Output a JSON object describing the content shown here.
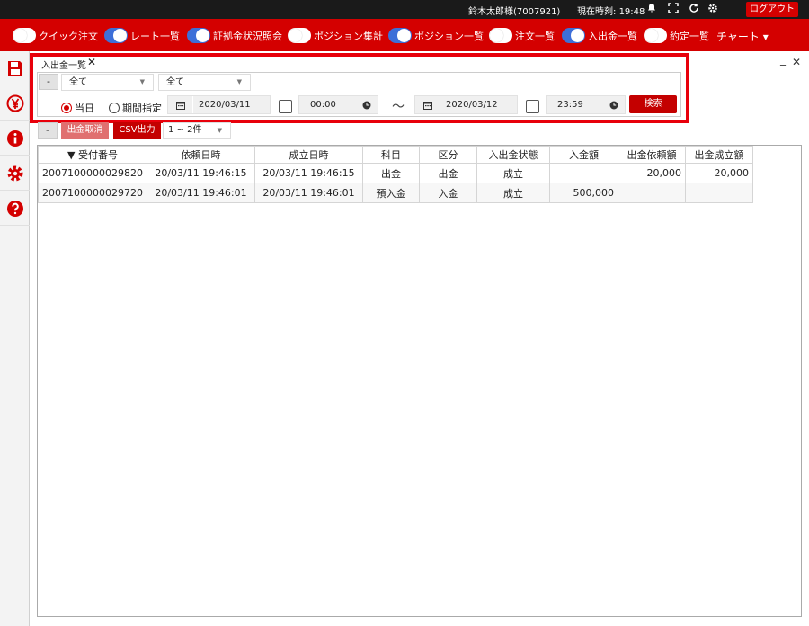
{
  "topbar": {
    "user": "鈴木太郎様(7007921)",
    "clock_label": "現在時刻:",
    "clock_value": "19:48",
    "logout_label": "ログアウト"
  },
  "toolbar": {
    "toggles": [
      {
        "label": "クイック注文",
        "on": false
      },
      {
        "label": "レート一覧",
        "on": true
      },
      {
        "label": "証拠金状況照会",
        "on": true
      },
      {
        "label": "ポジション集計",
        "on": false
      },
      {
        "label": "ポジション一覧",
        "on": true
      },
      {
        "label": "注文一覧",
        "on": false
      },
      {
        "label": "入出金一覧",
        "on": true
      },
      {
        "label": "約定一覧",
        "on": false
      }
    ],
    "chart_menu": "チャート ▾"
  },
  "sidebar": {
    "icons": [
      "save-icon",
      "yen-icon",
      "info-icon",
      "gear-icon",
      "help-icon"
    ]
  },
  "panel": {
    "title": "入出金一覧",
    "close_glyph": "✕",
    "minimize_glyph": "_",
    "panel_close_glyph": "✕"
  },
  "filter": {
    "collapse_label": "-",
    "select1": "全て",
    "select2": "全て",
    "radio_today": "当日",
    "radio_period": "期間指定",
    "date_from": "2020/03/11",
    "time_from": "00:00",
    "tilde": "～",
    "date_to": "2020/03/12",
    "time_to": "23:59",
    "search_label": "検索"
  },
  "actions": {
    "collapse_label": "-",
    "cancel_label": "出金取消",
    "csv_label": "CSV出力",
    "count_label": "1 ~ 2件"
  },
  "table": {
    "headers": [
      "▼ 受付番号",
      "依頼日時",
      "成立日時",
      "科目",
      "区分",
      "入出金状態",
      "入金額",
      "出金依頼額",
      "出金成立額"
    ],
    "rows": [
      [
        "2007100000029820",
        "20/03/11 19:46:15",
        "20/03/11 19:46:15",
        "出金",
        "出金",
        "成立",
        "",
        "20,000",
        "20,000"
      ],
      [
        "2007100000029720",
        "20/03/11 19:46:01",
        "20/03/11 19:46:01",
        "預入金",
        "入金",
        "成立",
        "500,000",
        "",
        ""
      ]
    ]
  },
  "colors": {
    "brand_red": "#d40000",
    "toggle_on": "#3d6fd8",
    "highlight": "#e8000b"
  }
}
